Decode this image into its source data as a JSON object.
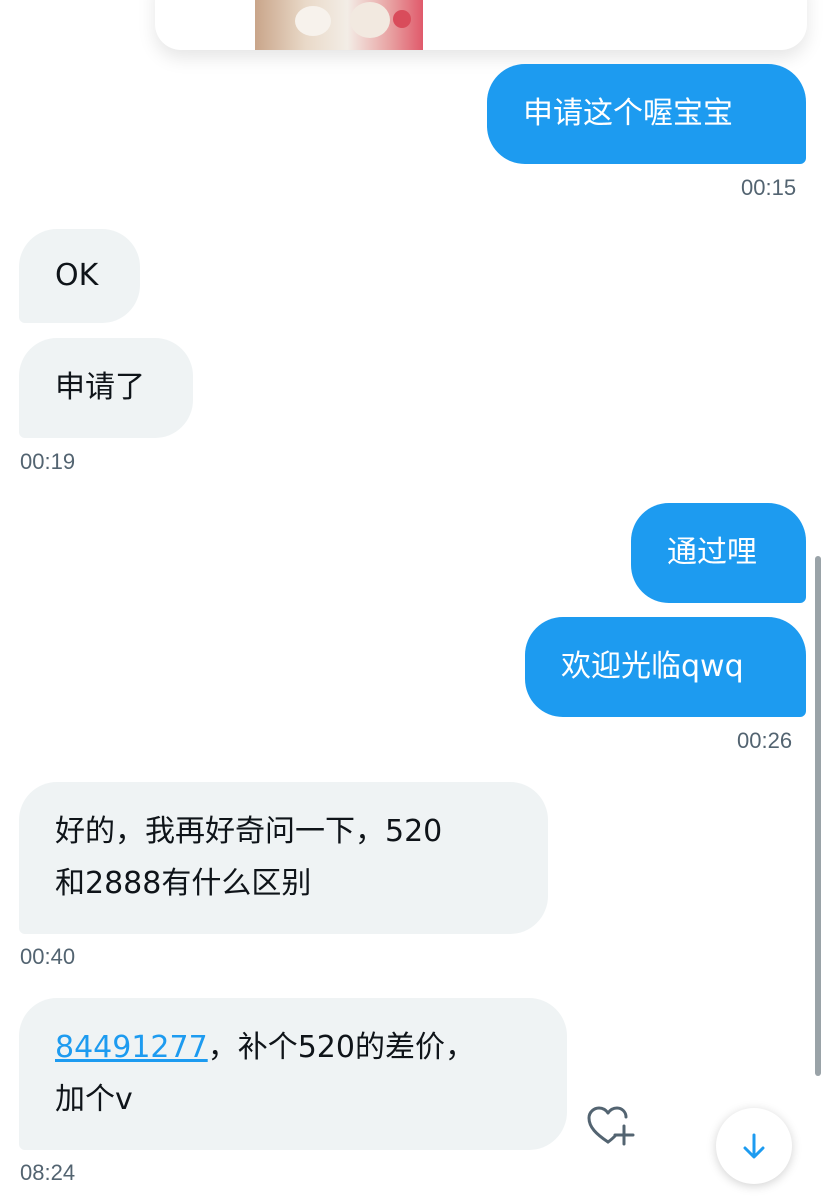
{
  "messages": [
    {
      "id": "m1",
      "dir": "out",
      "text": "申请这个喔宝宝",
      "time": "00:15"
    },
    {
      "id": "m2",
      "dir": "in",
      "text": "OK"
    },
    {
      "id": "m3",
      "dir": "in",
      "text": "申请了",
      "time": "00:19"
    },
    {
      "id": "m4",
      "dir": "out",
      "text": "通过哩"
    },
    {
      "id": "m5",
      "dir": "out",
      "text": "欢迎光临qwq",
      "time": "00:26"
    },
    {
      "id": "m6",
      "dir": "in",
      "line1": "好的，我再好奇问一下，520",
      "line2": "和2888有什么区别",
      "time": "00:40"
    },
    {
      "id": "m7",
      "dir": "in",
      "link": "84491277",
      "line1_rest": "，补个520的差价，",
      "line2": "加个v",
      "time": "08:24"
    }
  ],
  "icons": {
    "react": "heart-plus-icon",
    "scroll_down": "arrow-down-icon"
  },
  "colors": {
    "outgoing_bubble": "#1d9bf0",
    "incoming_bubble": "#eff3f4",
    "timestamp": "#536471",
    "link": "#1d9bf0"
  }
}
